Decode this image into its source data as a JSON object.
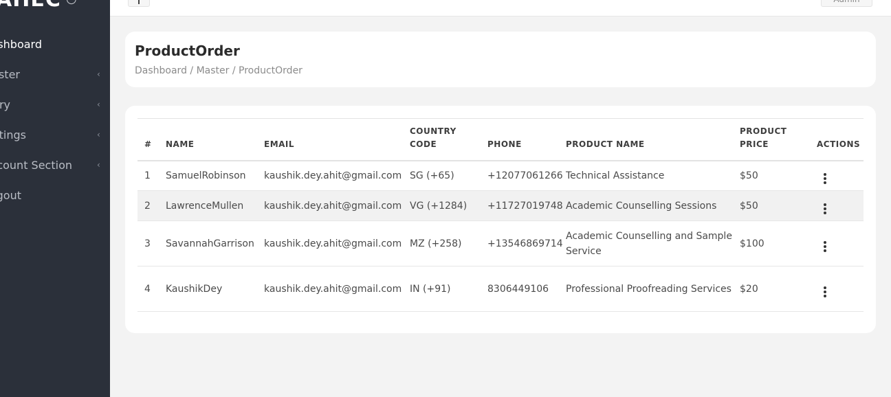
{
  "sidebar": {
    "brand": "AHEC",
    "items": [
      {
        "label": "shboard",
        "has_chevron": false
      },
      {
        "label": "ster",
        "has_chevron": true
      },
      {
        "label": "ry",
        "has_chevron": true
      },
      {
        "label": "tings",
        "has_chevron": true
      },
      {
        "label": "count Section",
        "has_chevron": true
      },
      {
        "label": "gout",
        "has_chevron": false
      }
    ]
  },
  "topbar": {
    "user_label": "Admin"
  },
  "page": {
    "title": "ProductOrder",
    "breadcrumb": "Dashboard / Master / ProductOrder"
  },
  "table": {
    "headers": [
      "#",
      "NAME",
      "EMAIL",
      "COUNTRY CODE",
      "PHONE",
      "PRODUCT NAME",
      "PRODUCT PRICE",
      "ACTIONS"
    ],
    "rows": [
      {
        "num": "1",
        "name": "SamuelRobinson",
        "email": "kaushik.dey.ahit@gmail.com",
        "code": "SG (+65)",
        "phone": "+12077061266",
        "product": "Technical Assistance",
        "price": "$50"
      },
      {
        "num": "2",
        "name": "LawrenceMullen",
        "email": "kaushik.dey.ahit@gmail.com",
        "code": "VG (+1284)",
        "phone": "+11727019748",
        "product": "Academic Counselling Sessions",
        "price": "$50"
      },
      {
        "num": "3",
        "name": "SavannahGarrison",
        "email": "kaushik.dey.ahit@gmail.com",
        "code": "MZ (+258)",
        "phone": "+13546869714",
        "product": "Academic Counselling and Sample Service",
        "price": "$100"
      },
      {
        "num": "4",
        "name": "KaushikDey",
        "email": "kaushik.dey.ahit@gmail.com",
        "code": "IN (+91)",
        "phone": "8306449106",
        "product": "Professional Proofreading Services",
        "price": "$20"
      }
    ]
  },
  "colors": {
    "sidebar_bg": "#2b303a",
    "page_bg": "#f3f3f3",
    "card_bg": "#ffffff",
    "row_highlight": "#f1f1f1"
  }
}
